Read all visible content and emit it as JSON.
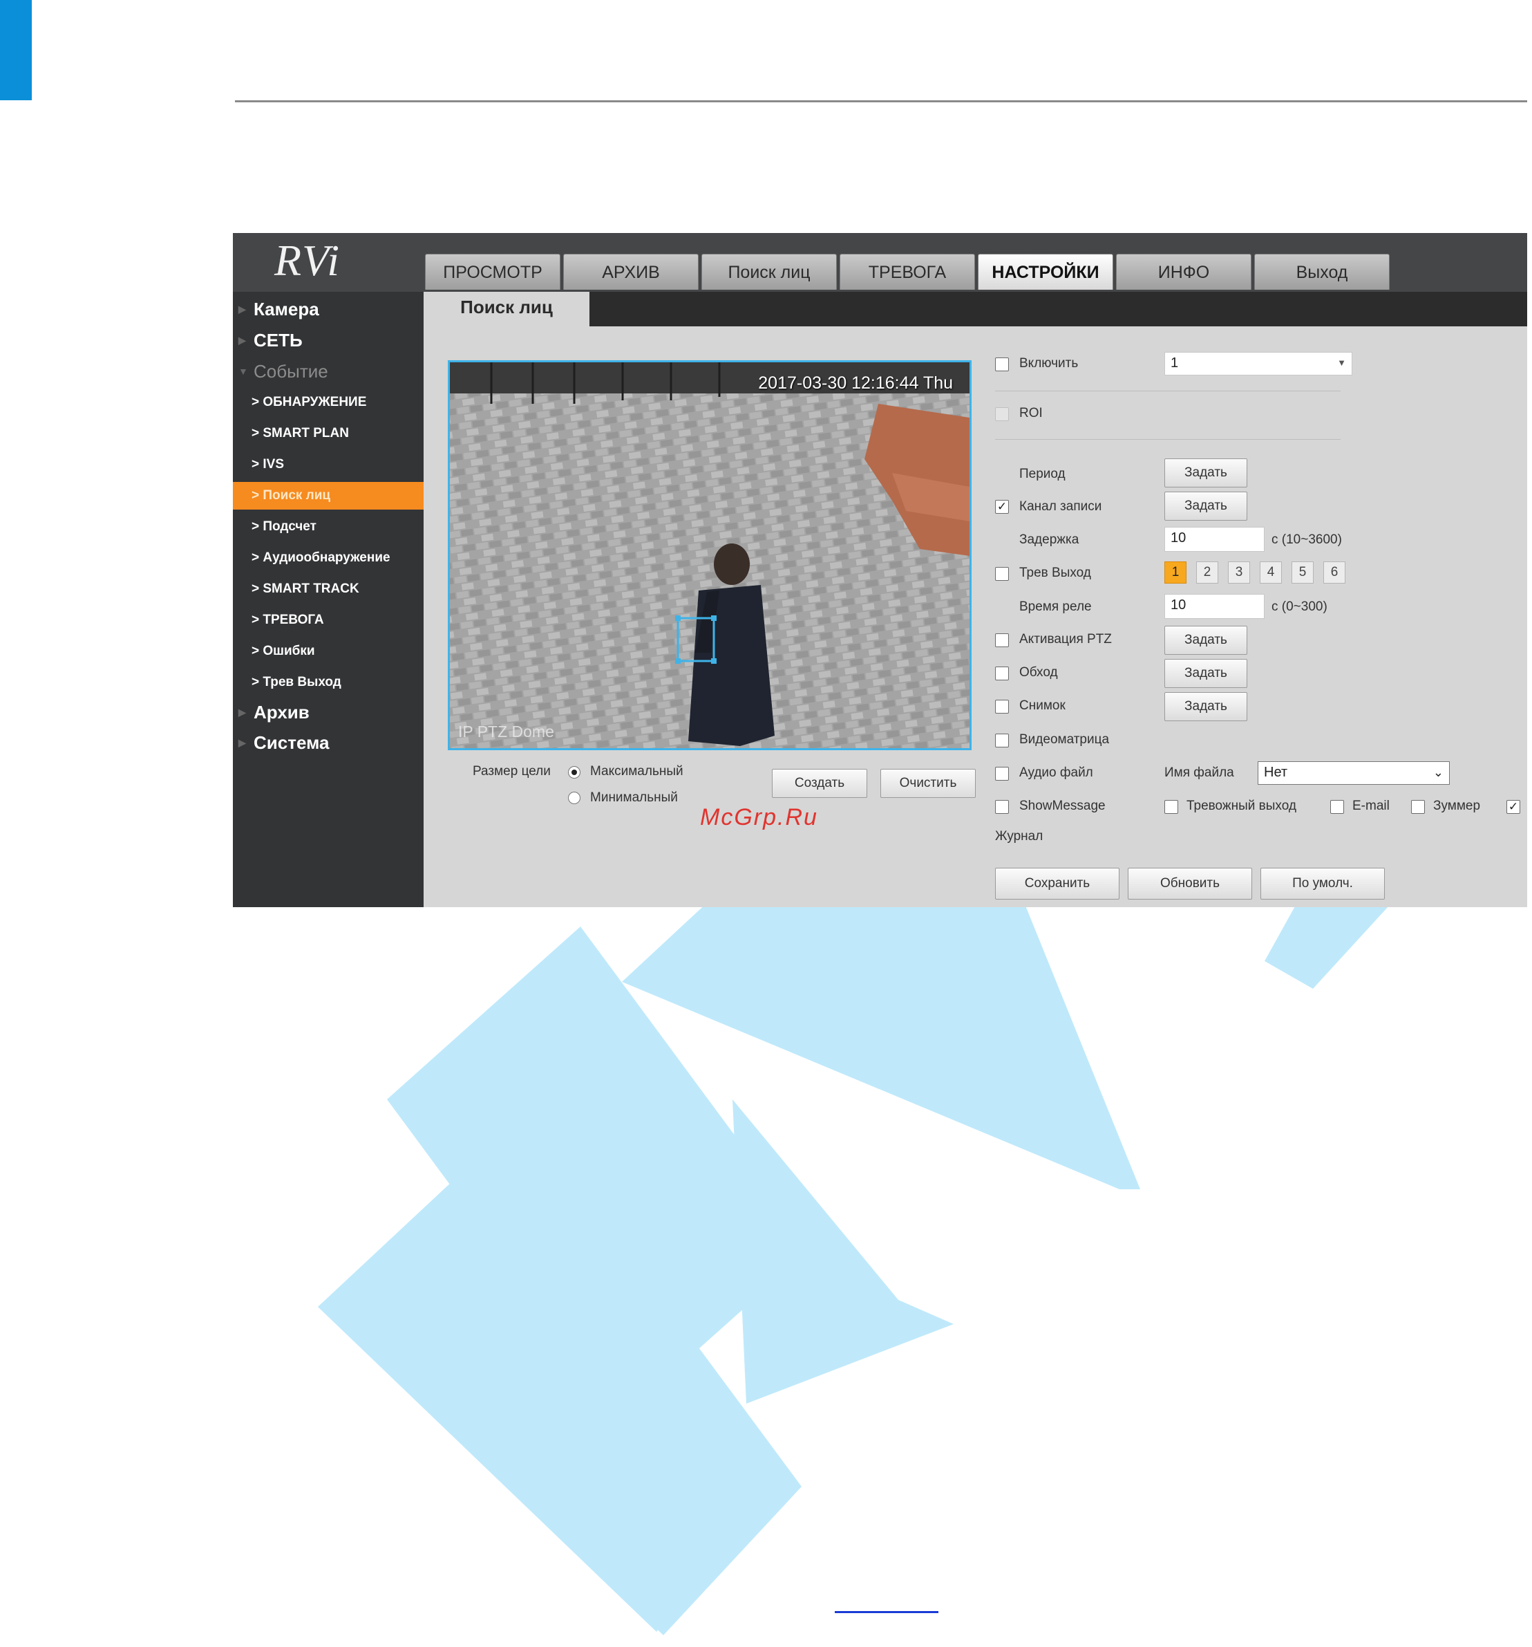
{
  "app": {
    "logo": "RVi",
    "tabs": [
      "ПРОСМОТР",
      "АРХИВ",
      "Поиск лиц",
      "ТРЕВОГА",
      "НАСТРОЙКИ",
      "ИНФО",
      "Выход"
    ],
    "active_tab": "НАСТРОЙКИ"
  },
  "sidebar": {
    "camera": "Камера",
    "network": "СЕТЬ",
    "event": "Событие",
    "items": [
      "ОБНАРУЖЕНИЕ",
      "SMART PLAN",
      "IVS",
      "Поиск лиц",
      "Подсчет",
      "Аудиообнаружение",
      "SMART TRACK",
      "ТРЕВОГА",
      "Ошибки",
      "Трев Выход"
    ],
    "active_item": "Поиск лиц",
    "archive": "Архив",
    "system": "Система"
  },
  "page": {
    "subtab": "Поиск лиц"
  },
  "video": {
    "timestamp": "2017-03-30 12:16:44 Thu",
    "camera_label": "IP PTZ Dome"
  },
  "target_size": {
    "label": "Размер цели",
    "option_max": "Максимальный",
    "option_min": "Минимальный",
    "selected": "Максимальный"
  },
  "video_buttons": {
    "create": "Создать",
    "clear": "Очистить"
  },
  "settings": {
    "enable_label": "Включить",
    "enable_checked": false,
    "channel_value": "1",
    "roi_label": "ROI",
    "period_label": "Период",
    "set_label": "Задать",
    "record_channel_label": "Канал записи",
    "record_channel_checked": true,
    "delay_label": "Задержка",
    "delay_value": "10",
    "delay_range": "с (10~3600)",
    "alarm_out_label": "Трев Выход",
    "alarm_out_checked": false,
    "alarm_outputs": [
      "1",
      "2",
      "3",
      "4",
      "5",
      "6"
    ],
    "alarm_out_selected": "1",
    "relay_time_label": "Время реле",
    "relay_time_value": "10",
    "relay_time_range": "с (0~300)",
    "ptz_label": "Активация PTZ",
    "tour_label": "Обход",
    "snapshot_label": "Снимок",
    "video_matrix_label": "Видеоматрица",
    "audio_file_label": "Аудио файл",
    "file_name_label": "Имя файла",
    "file_name_value": "Нет",
    "show_message_label": "ShowMessage",
    "alarm_upload_label": "Тревожный выход",
    "email_label": "E-mail",
    "buzzer_label": "Зуммер",
    "log_label": "Журнал"
  },
  "footer_buttons": {
    "save": "Сохранить",
    "refresh": "Обновить",
    "default": "По умолч."
  },
  "watermark_text": "McGrp.Ru",
  "colors": {
    "accent_blue": "#0a8fd8",
    "active_orange": "#f68b1f",
    "watermark_blue": "#bfe9fb",
    "video_border": "#3fb3e8"
  }
}
